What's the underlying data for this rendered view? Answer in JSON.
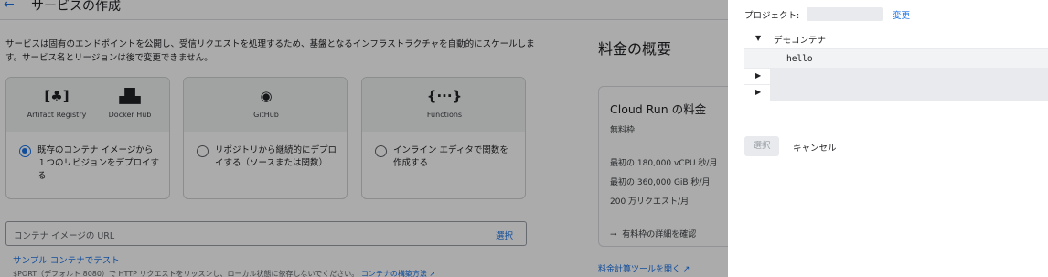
{
  "header": {
    "back_icon": "←",
    "title": "サービスの作成"
  },
  "description": "サービスは固有のエンドポイントを公開し、受信リクエストを処理するため、基盤となるインフラストラクチャを自動的にスケールします。サービス名とリージョンは後で変更できません。",
  "sources": [
    {
      "icons": [
        {
          "glyph": "[♣]",
          "label": "Artifact Registry"
        },
        {
          "glyph": "▟▙",
          "label": "Docker Hub"
        }
      ],
      "option": "既存のコンテナ イメージから１つのリビジョンをデプロイする",
      "selected": true
    },
    {
      "icons": [
        {
          "glyph": "◉",
          "label": "GitHub"
        }
      ],
      "option": "リポジトリから継続的にデプロイする（ソースまたは関数）",
      "selected": false
    },
    {
      "icons": [
        {
          "glyph": "{···}",
          "label": "Functions"
        }
      ],
      "option": "インライン エディタで関数を作成する",
      "selected": false
    }
  ],
  "image_url": {
    "placeholder": "コンテナ イメージの URL",
    "select_label": "選択"
  },
  "sample_link": "サンプル コンテナでテスト",
  "port_note": {
    "text": "$PORT（デフォルト 8080）で HTTP リクエストをリッスンし、ローカル状態に依存しないでください。",
    "link": "コンテナの構築方法",
    "link_icon": "↗"
  },
  "pricing": {
    "title": "料金の概要",
    "card_title": "Cloud Run の料金",
    "free_tier": "無料枠",
    "tiers": [
      "最初の 180,000 vCPU 秒/月",
      "最初の 360,000 GiB 秒/月",
      "200 万リクエスト/月"
    ],
    "detail_icon": "→",
    "detail_link": "有料枠の詳細を確認",
    "calc_link": "料金計算ツールを開く",
    "calc_icon": "↗"
  },
  "dialog": {
    "project_label": "プロジェクト:",
    "project_change": "変更",
    "tree": {
      "repo_caret": "▼",
      "repo_name": "デモコンテナ",
      "child": "hello",
      "collapsed_caret": "▶"
    },
    "select_button": "選択",
    "cancel_button": "キャンセル"
  }
}
